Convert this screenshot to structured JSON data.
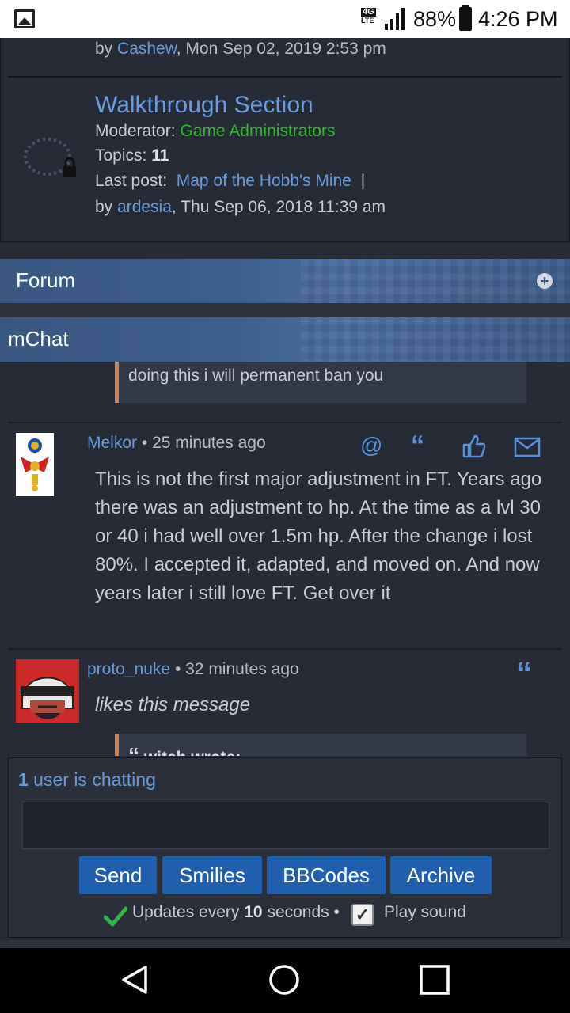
{
  "status_bar": {
    "network_badge": "4G",
    "network_type": "LTE",
    "battery_percent": "88%",
    "time": "4:26 PM"
  },
  "forum": {
    "prev_post_by_label": "by",
    "prev_post_user": "Cashew",
    "prev_post_date": ", Mon Sep 02, 2019 2:53 pm",
    "title": "Walkthrough Section",
    "moderator_label": "Moderator:",
    "moderator_value": "Game Administrators",
    "topics_label": "Topics:",
    "topics_value": "11",
    "last_post_label": "Last post:",
    "last_post_title": "Map of the Hobb's Mine",
    "last_post_sep": "|",
    "last_post_by_label": "by",
    "last_post_user": "ardesia",
    "last_post_date": ", Thu Sep 06, 2018 11:39 am"
  },
  "sections": {
    "forum_header": "Forum",
    "mchat_header": "mChat"
  },
  "chat": {
    "quote_partial_text": "doing this i will permanent ban you",
    "messages": [
      {
        "username": "Melkor",
        "time": "• 25 minutes ago",
        "text": "This is not the first major adjustment in FT. Years ago there was an adjustment to hp. At the time as a lvl 30 or 40 i had well over 1.5m hp. After the change i lost 80%. I accepted it, adapted, and moved on. And now years later i still love FT. Get over it"
      },
      {
        "username": "proto_nuke",
        "time": "• 32 minutes ago",
        "text": "likes this message"
      }
    ],
    "bottom_quote_label": "witch wrote:"
  },
  "panel": {
    "users_count": "1",
    "users_text": " user is chatting",
    "buttons": {
      "send": "Send",
      "smilies": "Smilies",
      "bbcodes": "BBCodes",
      "archive": "Archive"
    },
    "updates_prefix": "Updates every ",
    "updates_seconds": "10",
    "updates_suffix": " seconds •",
    "play_sound": "Play sound"
  }
}
